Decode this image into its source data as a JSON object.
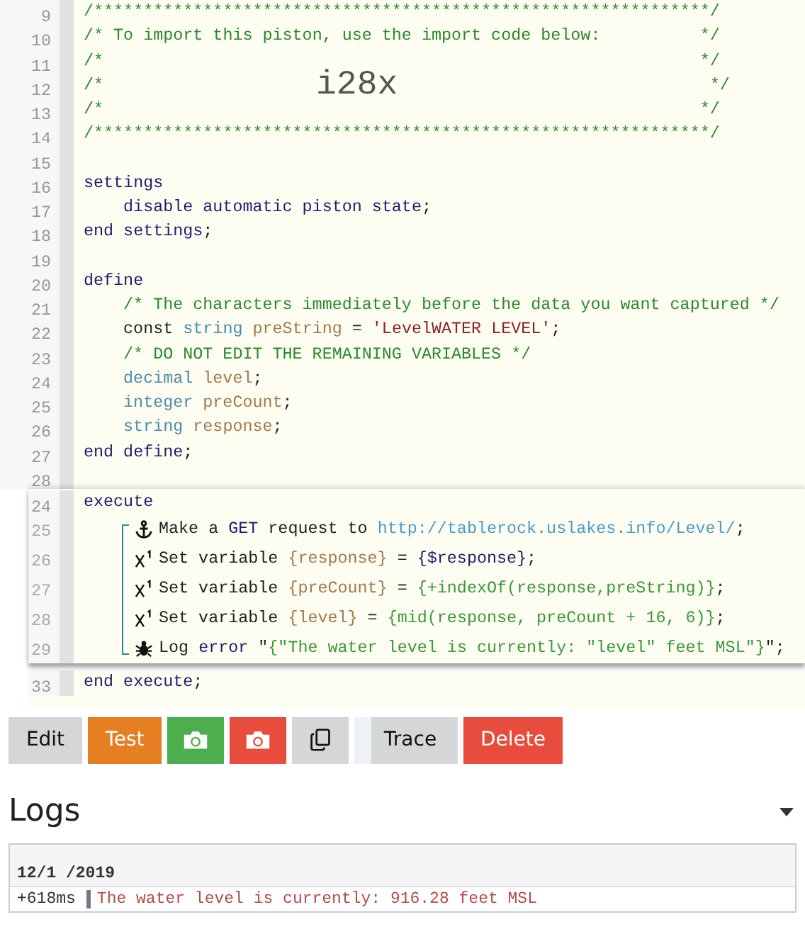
{
  "panels": [
    {
      "kind": "base",
      "lines": [
        {
          "number": "9",
          "kind": "code",
          "tokens": [
            {
              "kind": "comment",
              "text": "/**************************************************************/"
            }
          ]
        },
        {
          "number": "10",
          "kind": "code",
          "tokens": [
            {
              "kind": "comment",
              "text": "/* To import this piston, use the import code below:          */"
            }
          ]
        },
        {
          "number": "11",
          "kind": "code",
          "tokens": [
            {
              "kind": "comment",
              "text": "/*                                                            */"
            }
          ]
        },
        {
          "number": "12",
          "kind": "banner",
          "tokens": [
            {
              "kind": "comment",
              "text": "/*"
            },
            {
              "kind": "big",
              "text": "i28x"
            },
            {
              "kind": "comment",
              "text": "*/"
            }
          ]
        },
        {
          "number": "13",
          "kind": "code",
          "tokens": [
            {
              "kind": "comment",
              "text": "/*                                                            */"
            }
          ]
        },
        {
          "number": "14",
          "kind": "code",
          "tokens": [
            {
              "kind": "comment",
              "text": "/**************************************************************/"
            }
          ]
        },
        {
          "number": "15",
          "kind": "code"
        },
        {
          "number": "16",
          "kind": "code",
          "tokens": [
            {
              "kind": "keyword",
              "text": "settings"
            }
          ]
        },
        {
          "number": "17",
          "kind": "indented",
          "tokens": [
            {
              "kind": "keyword",
              "text": "disable automatic piston state"
            },
            {
              "kind": "plain",
              "text": ";"
            }
          ]
        },
        {
          "number": "18",
          "kind": "code",
          "tokens": [
            {
              "kind": "keyword",
              "text": "end settings"
            },
            {
              "kind": "plain",
              "text": ";"
            }
          ]
        },
        {
          "number": "19",
          "kind": "code"
        },
        {
          "number": "20",
          "kind": "code",
          "tokens": [
            {
              "kind": "keyword",
              "text": "define"
            }
          ]
        },
        {
          "number": "21",
          "kind": "indented",
          "tokens": [
            {
              "kind": "comment",
              "text": "/* The characters immediately before the data you want captured */"
            }
          ]
        },
        {
          "number": "22",
          "kind": "indented",
          "tokens": [
            {
              "kind": "plain",
              "text": "const "
            },
            {
              "kind": "type",
              "text": "string "
            },
            {
              "kind": "var",
              "text": "preString"
            },
            {
              "kind": "plain",
              "text": " = "
            },
            {
              "kind": "string",
              "text": "'LevelWATER LEVEL'"
            },
            {
              "kind": "plain",
              "text": ";"
            }
          ]
        },
        {
          "number": "23",
          "kind": "indented",
          "tokens": [
            {
              "kind": "comment",
              "text": "/* DO NOT EDIT THE REMAINING VARIABLES */"
            }
          ]
        },
        {
          "number": "24",
          "kind": "indented",
          "tokens": [
            {
              "kind": "type",
              "text": "decimal "
            },
            {
              "kind": "var",
              "text": "level"
            },
            {
              "kind": "plain",
              "text": ";"
            }
          ]
        },
        {
          "number": "25",
          "kind": "indented",
          "tokens": [
            {
              "kind": "type",
              "text": "integer "
            },
            {
              "kind": "var",
              "text": "preCount"
            },
            {
              "kind": "plain",
              "text": ";"
            }
          ]
        },
        {
          "number": "26",
          "kind": "indented",
          "tokens": [
            {
              "kind": "type",
              "text": "string "
            },
            {
              "kind": "var",
              "text": "response"
            },
            {
              "kind": "plain",
              "text": ";"
            }
          ]
        },
        {
          "number": "27",
          "kind": "code",
          "tokens": [
            {
              "kind": "keyword",
              "text": "end define"
            },
            {
              "kind": "plain",
              "text": ";"
            }
          ]
        },
        {
          "number": "28",
          "kind": "code"
        }
      ]
    },
    {
      "kind": "overlay",
      "lines": [
        {
          "number": "24",
          "kind": "code",
          "tokens": [
            {
              "kind": "keyword",
              "text": "execute"
            }
          ]
        },
        {
          "number": "25",
          "kind": "request",
          "tokens": [
            {
              "kind": "plain",
              "text": "Make a "
            },
            {
              "kind": "keyword",
              "text": "GET"
            },
            {
              "kind": "plain",
              "text": " request to "
            },
            {
              "kind": "link",
              "text": "http://tablerock.uslakes.info/Level/"
            },
            {
              "kind": "plain",
              "text": ";"
            }
          ]
        },
        {
          "number": "26",
          "kind": "assign",
          "tokens": [
            {
              "kind": "plain",
              "text": "Set variable "
            },
            {
              "kind": "var",
              "text": "{response}"
            },
            {
              "kind": "plain",
              "text": " = "
            },
            {
              "kind": "keyword",
              "text": "{$response}"
            },
            {
              "kind": "plain",
              "text": ";"
            }
          ]
        },
        {
          "number": "27",
          "kind": "assign",
          "tokens": [
            {
              "kind": "plain",
              "text": "Set variable "
            },
            {
              "kind": "var",
              "text": "{preCount}"
            },
            {
              "kind": "plain",
              "text": " = "
            },
            {
              "kind": "expr",
              "text": "{+indexOf(response,preString)}"
            },
            {
              "kind": "plain",
              "text": ";"
            }
          ]
        },
        {
          "number": "28",
          "kind": "assign",
          "tokens": [
            {
              "kind": "plain",
              "text": "Set variable "
            },
            {
              "kind": "var",
              "text": "{level}"
            },
            {
              "kind": "plain",
              "text": " = "
            },
            {
              "kind": "expr",
              "text": "{mid(response, preCount + 16, 6)}"
            },
            {
              "kind": "plain",
              "text": ";"
            }
          ]
        },
        {
          "number": "29",
          "kind": "log",
          "tokens": [
            {
              "kind": "plain",
              "text": "Log "
            },
            {
              "kind": "keyword",
              "text": "error"
            },
            {
              "kind": "plain",
              "text": " \""
            },
            {
              "kind": "expr",
              "text": "{\"The water level is currently: \"level\" feet MSL\"}"
            },
            {
              "kind": "plain",
              "text": "\";"
            }
          ]
        }
      ]
    },
    {
      "kind": "base",
      "lines": [
        {
          "number": "33",
          "kind": "code",
          "tokens": [
            {
              "kind": "keyword",
              "text": "end execute"
            },
            {
              "kind": "plain",
              "text": ";"
            }
          ]
        }
      ]
    }
  ],
  "buttons": [
    {
      "kind": "text",
      "label": "Edit",
      "color": "#d4d6d8"
    },
    {
      "kind": "text",
      "label": "Test",
      "color": "#e67e22"
    },
    {
      "kind": "camera",
      "color": "#4cae4c"
    },
    {
      "kind": "camera",
      "color": "#e74c3c"
    },
    {
      "kind": "copy",
      "color": "#d4d6d8"
    },
    {
      "kind": "toggle",
      "label": "Trace",
      "color": "#d4d6d8"
    },
    {
      "kind": "text",
      "label": "Delete",
      "color": "#e74c3c"
    }
  ],
  "logs": {
    "title": "Logs",
    "date": "12/1 /2019",
    "entries": [
      {
        "time": "+618ms",
        "message": "The water level is currently: 916.28 feet MSL"
      }
    ]
  }
}
